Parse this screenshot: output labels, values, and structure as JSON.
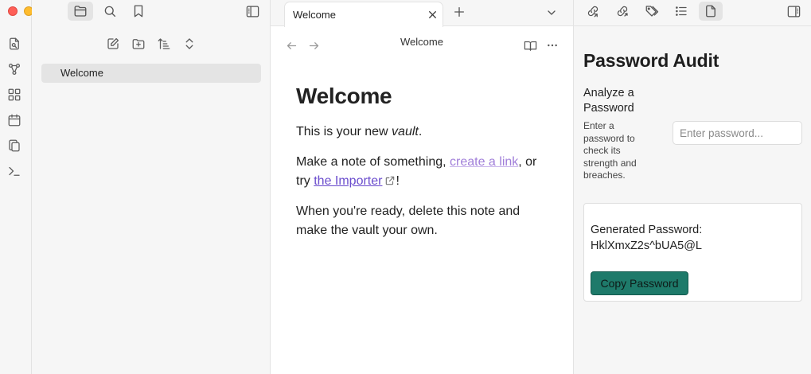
{
  "window": {
    "traffic_lights": {
      "close": "#fe5f57",
      "minimize": "#febc2e",
      "zoom": "#28c840"
    }
  },
  "ribbon": {
    "items": [
      {
        "icon": "open-quick-switcher-icon"
      },
      {
        "icon": "graph-view-icon"
      },
      {
        "icon": "canvas-icon"
      },
      {
        "icon": "daily-note-icon"
      },
      {
        "icon": "templates-icon"
      },
      {
        "icon": "command-palette-icon"
      }
    ]
  },
  "sidebar": {
    "top_tabs": [
      {
        "icon": "files-icon",
        "active": true
      },
      {
        "icon": "search-icon",
        "active": false
      },
      {
        "icon": "bookmarks-icon",
        "active": false
      }
    ],
    "toggle_icon": "sidebar-toggle-icon",
    "nav_actions": [
      {
        "icon": "new-note-icon"
      },
      {
        "icon": "new-folder-icon"
      },
      {
        "icon": "sort-icon"
      },
      {
        "icon": "collapse-expand-icon"
      }
    ],
    "files": [
      {
        "name": "Welcome",
        "selected": true
      }
    ]
  },
  "editor": {
    "tab": {
      "label": "Welcome"
    },
    "view_title": "Welcome",
    "document": {
      "heading": "Welcome",
      "para1_before": "This is your new ",
      "para1_em": "vault",
      "para1_after": ".",
      "para2_before": "Make a note of something, ",
      "para2_link1": "create a link",
      "para2_mid": ", or try ",
      "para2_link2": "the Importer",
      "para2_after": "!",
      "para3": "When you're ready, delete this note and make the vault your own."
    }
  },
  "right_panel": {
    "tabs": [
      {
        "icon": "backlinks-icon",
        "active": false
      },
      {
        "icon": "outgoing-links-icon",
        "active": false
      },
      {
        "icon": "tags-icon",
        "active": false
      },
      {
        "icon": "outline-icon",
        "active": false
      },
      {
        "icon": "file-icon",
        "active": true
      }
    ],
    "title": "Password Audit",
    "analyze_heading": "Analyze a Password",
    "analyze_description": "Enter a password to check its strength and breaches.",
    "password_placeholder": "Enter password...",
    "generated_label": "Generated Password:",
    "generated_value": "HklXmxZ2s^bUA5@L",
    "copy_button": "Copy Password",
    "accent_color": "#1e7a6a"
  }
}
